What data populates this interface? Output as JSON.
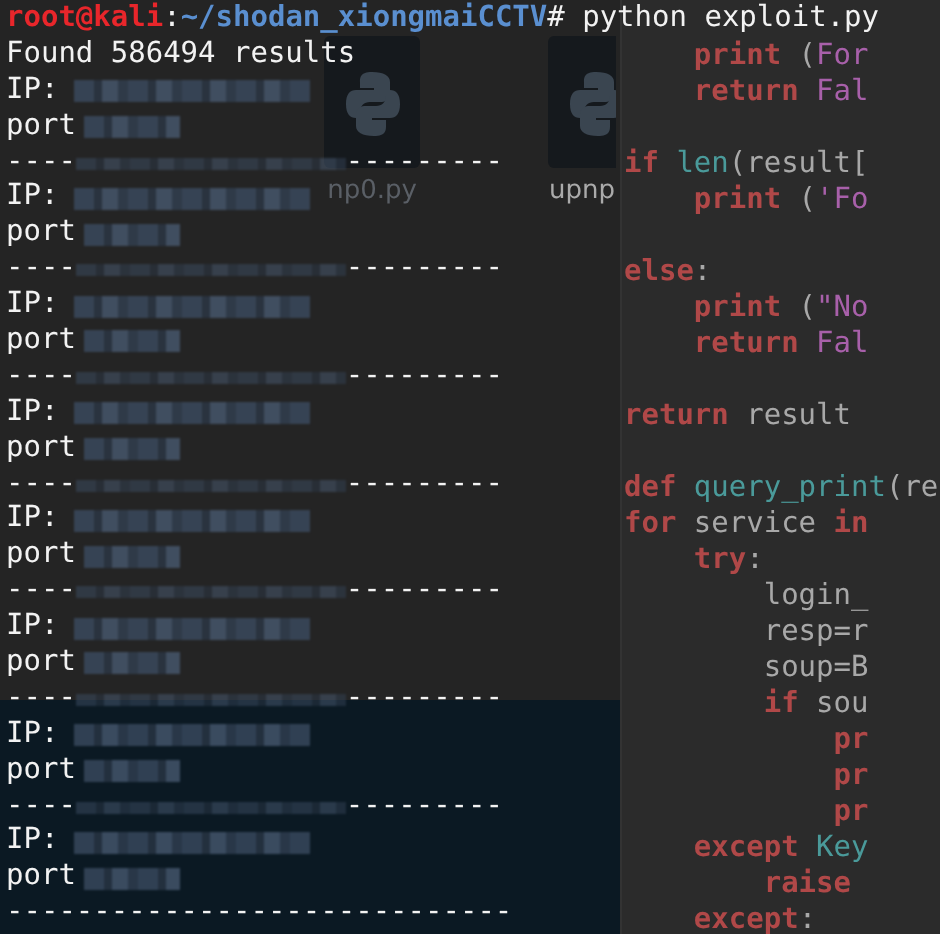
{
  "desktop": {
    "icons": [
      {
        "label": "np0.py"
      },
      {
        "label": "upnp"
      }
    ]
  },
  "editor": {
    "lines": [
      {
        "kind": "blank"
      },
      {
        "kind": "code",
        "segments": [
          {
            "text": "    print",
            "kind": "keyword"
          },
          {
            "text": " (",
            "kind": "plain"
          },
          {
            "text": "For",
            "kind": "string"
          }
        ]
      },
      {
        "kind": "code",
        "segments": [
          {
            "text": "    return",
            "kind": "keyword"
          },
          {
            "text": " Fal",
            "kind": "string"
          }
        ]
      },
      {
        "kind": "blank"
      },
      {
        "kind": "code",
        "segments": [
          {
            "text": "if",
            "kind": "keyword"
          },
          {
            "text": " len",
            "kind": "builtin"
          },
          {
            "text": "(result[",
            "kind": "plain"
          }
        ]
      },
      {
        "kind": "code",
        "segments": [
          {
            "text": "    print",
            "kind": "keyword"
          },
          {
            "text": " (",
            "kind": "plain"
          },
          {
            "text": "'Fo",
            "kind": "string"
          }
        ]
      },
      {
        "kind": "blank"
      },
      {
        "kind": "code",
        "segments": [
          {
            "text": "else",
            "kind": "keyword"
          },
          {
            "text": ":",
            "kind": "plain"
          }
        ]
      },
      {
        "kind": "code",
        "segments": [
          {
            "text": "    print",
            "kind": "keyword"
          },
          {
            "text": " (",
            "kind": "plain"
          },
          {
            "text": "\"No",
            "kind": "string"
          }
        ]
      },
      {
        "kind": "code",
        "segments": [
          {
            "text": "    return",
            "kind": "keyword"
          },
          {
            "text": " Fal",
            "kind": "string"
          }
        ]
      },
      {
        "kind": "blank"
      },
      {
        "kind": "code",
        "segments": [
          {
            "text": "return",
            "kind": "keyword"
          },
          {
            "text": " result",
            "kind": "plain"
          }
        ]
      },
      {
        "kind": "blank"
      },
      {
        "kind": "code",
        "segments": [
          {
            "text": "def",
            "kind": "keyword"
          },
          {
            "text": " query_print",
            "kind": "builtin"
          },
          {
            "text": "(re",
            "kind": "plain"
          }
        ]
      },
      {
        "kind": "code",
        "segments": [
          {
            "text": "for",
            "kind": "keyword"
          },
          {
            "text": " service ",
            "kind": "plain"
          },
          {
            "text": "in",
            "kind": "keyword"
          }
        ]
      },
      {
        "kind": "code",
        "segments": [
          {
            "text": "    try",
            "kind": "keyword"
          },
          {
            "text": ":",
            "kind": "plain"
          }
        ]
      },
      {
        "kind": "code",
        "segments": [
          {
            "text": "        login_",
            "kind": "plain"
          }
        ]
      },
      {
        "kind": "code",
        "segments": [
          {
            "text": "        resp=r",
            "kind": "plain"
          }
        ]
      },
      {
        "kind": "code",
        "segments": [
          {
            "text": "        soup=B",
            "kind": "plain"
          }
        ]
      },
      {
        "kind": "code",
        "segments": [
          {
            "text": "        if",
            "kind": "keyword"
          },
          {
            "text": " sou",
            "kind": "plain"
          }
        ]
      },
      {
        "kind": "code",
        "segments": [
          {
            "text": "            pr",
            "kind": "keyword"
          }
        ]
      },
      {
        "kind": "code",
        "segments": [
          {
            "text": "            pr",
            "kind": "keyword"
          }
        ]
      },
      {
        "kind": "code",
        "segments": [
          {
            "text": "            pr",
            "kind": "keyword"
          }
        ]
      },
      {
        "kind": "code",
        "segments": [
          {
            "text": "    except",
            "kind": "keyword"
          },
          {
            "text": " Key",
            "kind": "builtin"
          }
        ]
      },
      {
        "kind": "code",
        "segments": [
          {
            "text": "        raise",
            "kind": "keyword"
          }
        ]
      },
      {
        "kind": "code",
        "segments": [
          {
            "text": "    except",
            "kind": "keyword"
          },
          {
            "text": ":",
            "kind": "plain"
          }
        ]
      }
    ]
  },
  "terminal": {
    "prompt": {
      "user_host": "root@kali",
      "separator": ":",
      "path": "~/shodan_xiongmaiCCTV",
      "symbol": "#",
      "command": "python exploit.py"
    },
    "summary": "Found 586494 results",
    "results": [
      {
        "ip_label": "IP:",
        "port_label": "port",
        "separator": {
          "kind": "redacted",
          "left": "----",
          "right": "---------"
        }
      },
      {
        "ip_label": "IP:",
        "port_label": "port",
        "separator": {
          "kind": "redacted",
          "left": "----",
          "right": "---------"
        }
      },
      {
        "ip_label": "IP:",
        "port_label": "port",
        "separator": {
          "kind": "redacted",
          "left": "----",
          "right": "---------"
        }
      },
      {
        "ip_label": "IP:",
        "port_label": "port",
        "separator": {
          "kind": "redacted",
          "left": "----",
          "right": "---------"
        }
      },
      {
        "ip_label": "IP:",
        "port_label": "port",
        "separator": {
          "kind": "redacted",
          "left": "----",
          "right": "---------"
        }
      },
      {
        "ip_label": "IP:",
        "port_label": "port",
        "separator": {
          "kind": "redacted",
          "left": "----",
          "right": "---------"
        }
      },
      {
        "ip_label": "IP:",
        "port_label": "port",
        "separator": {
          "kind": "redacted",
          "left": "----",
          "right": "---------"
        }
      },
      {
        "ip_label": "IP:",
        "port_label": "port",
        "separator": {
          "kind": "plain",
          "text": "-----------------------------"
        }
      }
    ]
  }
}
